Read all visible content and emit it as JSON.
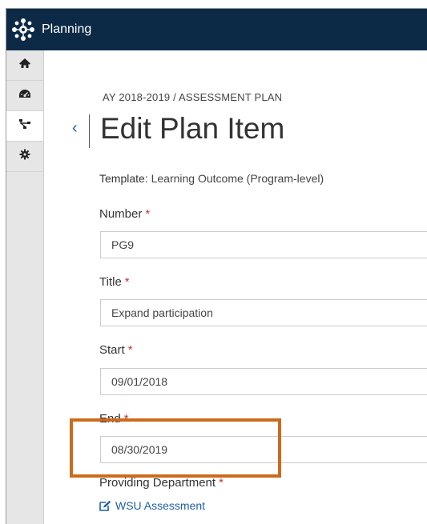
{
  "app": {
    "title": "Planning"
  },
  "sidebar": {
    "items": [
      {
        "icon": "home-icon"
      },
      {
        "icon": "dashboard-icon"
      },
      {
        "icon": "hierarchy-icon",
        "active": true
      },
      {
        "icon": "gear-icon"
      }
    ]
  },
  "page": {
    "breadcrumb": "AY 2018-2019 / ASSESSMENT PLAN",
    "back_glyph": "‹",
    "title": "Edit Plan Item"
  },
  "form": {
    "template_label": "Template:",
    "template_value": "Learning Outcome (Program-level)",
    "required_marker": "*",
    "number": {
      "label": "Number",
      "value": "PG9"
    },
    "title": {
      "label": "Title",
      "value": "Expand participation"
    },
    "start": {
      "label": "Start",
      "value": "09/01/2018"
    },
    "end": {
      "label": "End",
      "value": "08/30/2019"
    },
    "providing_department": {
      "label": "Providing Department",
      "value": "WSU Assessment"
    }
  },
  "colors": {
    "topbar": "#0c2a46",
    "link": "#1f5fa8",
    "required": "#c0392b",
    "highlight_box": "#cc6a1c"
  }
}
